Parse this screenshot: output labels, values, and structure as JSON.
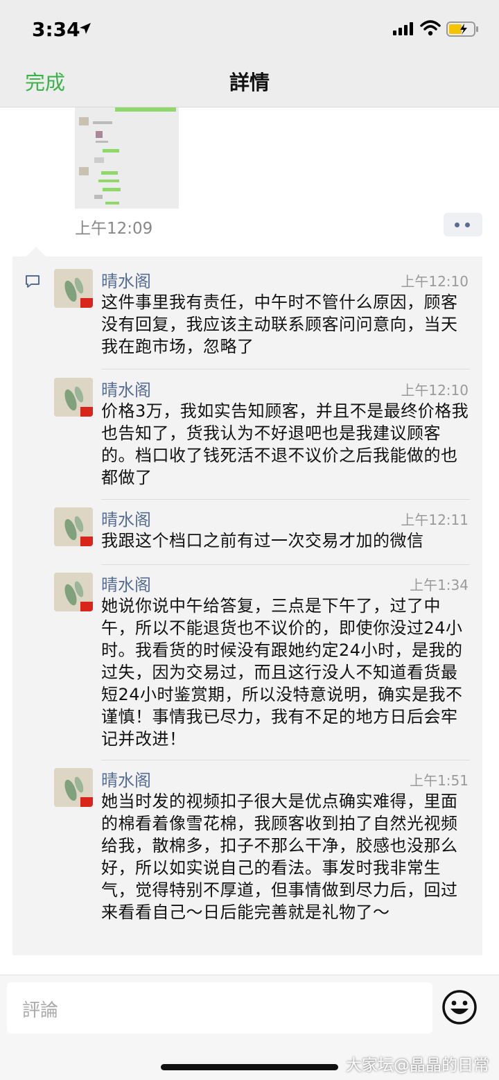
{
  "status_bar": {
    "time": "3:34"
  },
  "nav": {
    "done_label": "完成",
    "title": "詳情"
  },
  "post": {
    "time": "上午12:09"
  },
  "comments": [
    {
      "name": "晴水阁",
      "time": "上午12:10",
      "text": "这件事里我有责任，中午时不管什么原因，顾客没有回复，我应该主动联系顾客问问意向，当天我在跑市场，忽略了"
    },
    {
      "name": "晴水阁",
      "time": "上午12:10",
      "text": "价格3万，我如实告知顾客，并且不是最终价格我也告知了，货我认为不好退吧也是我建议顾客的。档口收了钱死活不退不议价之后我能做的也都做了"
    },
    {
      "name": "晴水阁",
      "time": "上午12:11",
      "text": "我跟这个档口之前有过一次交易才加的微信"
    },
    {
      "name": "晴水阁",
      "time": "上午1:34",
      "text": "她说你说中午给答复，三点是下午了，过了中午，所以不能退货也不议价的，即使你没过24小时。我看货的时候没有跟她约定24小时，是我的过失，因为交易过，而且这行没人不知道看货最短24小时鉴赏期，所以没特意说明，确实是我不谨慎！事情我已尽力，我有不足的地方日后会牢记并改进！"
    },
    {
      "name": "晴水阁",
      "time": "上午1:51",
      "text": "她当时发的视频扣子很大是优点确实难得，里面的棉看着像雪花棉，我顾客收到拍了自然光视频给我，散棉多，扣子不那么干净，胶感也没那么好，所以如实说自己的看法。事发时我非常生气，觉得特别不厚道，但事情做到尽力后，回过来看看自己～日后能完善就是礼物了～"
    }
  ],
  "input": {
    "placeholder": "評論"
  },
  "watermark": "大家坛@晶晶的日常",
  "colors": {
    "accent": "#3cb34a",
    "name": "#566c94"
  }
}
